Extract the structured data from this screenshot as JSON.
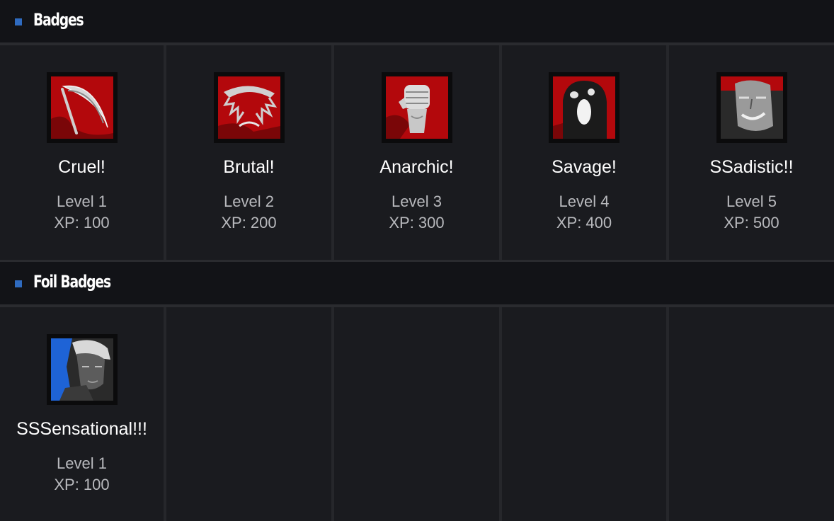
{
  "sections": [
    {
      "title": "Badges",
      "badges": [
        {
          "name": "Cruel!",
          "level": "Level 1",
          "xp": "XP: 100",
          "icon": "scythe-icon"
        },
        {
          "name": "Brutal!",
          "level": "Level 2",
          "xp": "XP: 200",
          "icon": "jagged-blade-icon"
        },
        {
          "name": "Anarchic!",
          "level": "Level 3",
          "xp": "XP: 300",
          "icon": "fist-icon"
        },
        {
          "name": "Savage!",
          "level": "Level 4",
          "xp": "XP: 400",
          "icon": "ghost-face-icon"
        },
        {
          "name": "SSadistic!!",
          "level": "Level 5",
          "xp": "XP: 500",
          "icon": "grinning-face-icon"
        }
      ]
    },
    {
      "title": "Foil Badges",
      "badges": [
        {
          "name": "SSSensational!!!",
          "level": "Level 1",
          "xp": "XP: 100",
          "icon": "portrait-icon"
        }
      ]
    }
  ],
  "colors": {
    "accent": "#2f6bc0",
    "badge_red": "#b3080c",
    "foil_blue": "#1e63d6"
  }
}
